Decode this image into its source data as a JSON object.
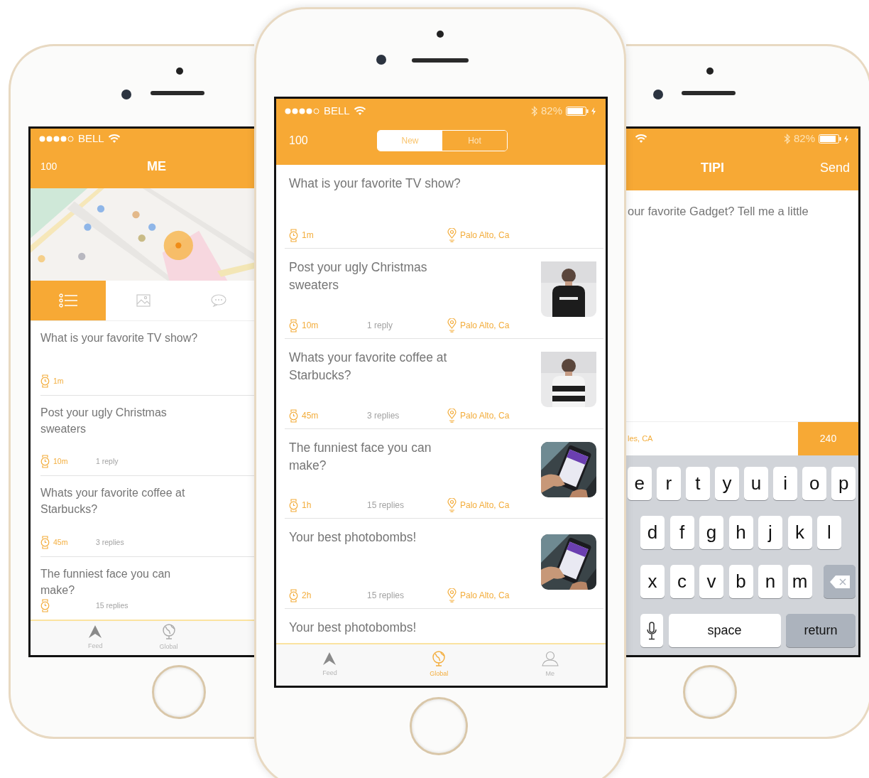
{
  "left_phone": {
    "status_bar": {
      "carrier": "BELL"
    },
    "header": {
      "count": "100",
      "title": "ME"
    },
    "view_tabs": [
      {
        "selected": true
      },
      {
        "selected": false
      },
      {
        "selected": false
      }
    ],
    "posts": [
      {
        "question": "What is your favorite TV show?",
        "time": "1m"
      },
      {
        "question": "Post your ugly Christmas sweaters",
        "time": "10m",
        "replies": "1 reply"
      },
      {
        "question": "Whats your favorite coffee at Starbucks?",
        "time": "45m",
        "replies": "3 replies"
      },
      {
        "question": "The funniest face you can make?",
        "replies": "15 replies"
      }
    ],
    "tab_bar": [
      {
        "label": "Feed",
        "selected": false
      },
      {
        "label": "Global",
        "selected": false
      }
    ]
  },
  "center_phone": {
    "status_bar": {
      "carrier": "BELL",
      "battery": "82%"
    },
    "header": {
      "count": "100"
    },
    "segments": [
      {
        "label": "New",
        "selected": true
      },
      {
        "label": "Hot",
        "selected": false
      }
    ],
    "posts": [
      {
        "question": "What is your favorite TV show?",
        "time": "1m",
        "location": "Palo Alto, Ca"
      },
      {
        "question": "Post your ugly Christmas sweaters",
        "time": "10m",
        "replies": "1 reply",
        "location": "Palo Alto, Ca"
      },
      {
        "question": "Whats your favorite coffee at Starbucks?",
        "time": "45m",
        "replies": "3 replies",
        "location": "Palo Alto, Ca"
      },
      {
        "question": "The funniest face you can make?",
        "time": "1h",
        "replies": "15 replies",
        "location": "Palo Alto, Ca"
      },
      {
        "question": "Your best photobombs!",
        "time": "2h",
        "replies": "15 replies",
        "location": "Palo Alto, Ca"
      },
      {
        "question": "Your best photobombs!"
      }
    ],
    "tab_bar": [
      {
        "label": "Feed",
        "selected": false
      },
      {
        "label": "Global",
        "selected": true
      },
      {
        "label": "Me",
        "selected": false
      }
    ]
  },
  "right_phone": {
    "status_bar": {
      "battery": "82%"
    },
    "header": {
      "title": "TIPI",
      "action": "Send"
    },
    "compose_text": "our favorite Gadget? Tell me a little",
    "location": "les, CA",
    "counter": "240",
    "keyboard": [
      [
        {
          "kind": "letter",
          "label": "e"
        },
        {
          "kind": "letter",
          "label": "r"
        },
        {
          "kind": "letter",
          "label": "t"
        },
        {
          "kind": "letter",
          "label": "y"
        },
        {
          "kind": "letter",
          "label": "u"
        },
        {
          "kind": "letter",
          "label": "i"
        },
        {
          "kind": "letter",
          "label": "o"
        },
        {
          "kind": "letter",
          "label": "p"
        }
      ],
      [
        {
          "kind": "letter",
          "label": "d"
        },
        {
          "kind": "letter",
          "label": "f"
        },
        {
          "kind": "letter",
          "label": "g"
        },
        {
          "kind": "letter",
          "label": "h"
        },
        {
          "kind": "letter",
          "label": "j"
        },
        {
          "kind": "letter",
          "label": "k"
        },
        {
          "kind": "letter",
          "label": "l"
        }
      ],
      [
        {
          "kind": "letter",
          "label": "x"
        },
        {
          "kind": "letter",
          "label": "c"
        },
        {
          "kind": "letter",
          "label": "v"
        },
        {
          "kind": "letter",
          "label": "b"
        },
        {
          "kind": "letter",
          "label": "n"
        },
        {
          "kind": "letter",
          "label": "m"
        },
        {
          "kind": "backspace"
        }
      ],
      [
        {
          "kind": "mic"
        },
        {
          "kind": "space",
          "label": "space"
        },
        {
          "kind": "return",
          "label": "return"
        }
      ]
    ]
  }
}
